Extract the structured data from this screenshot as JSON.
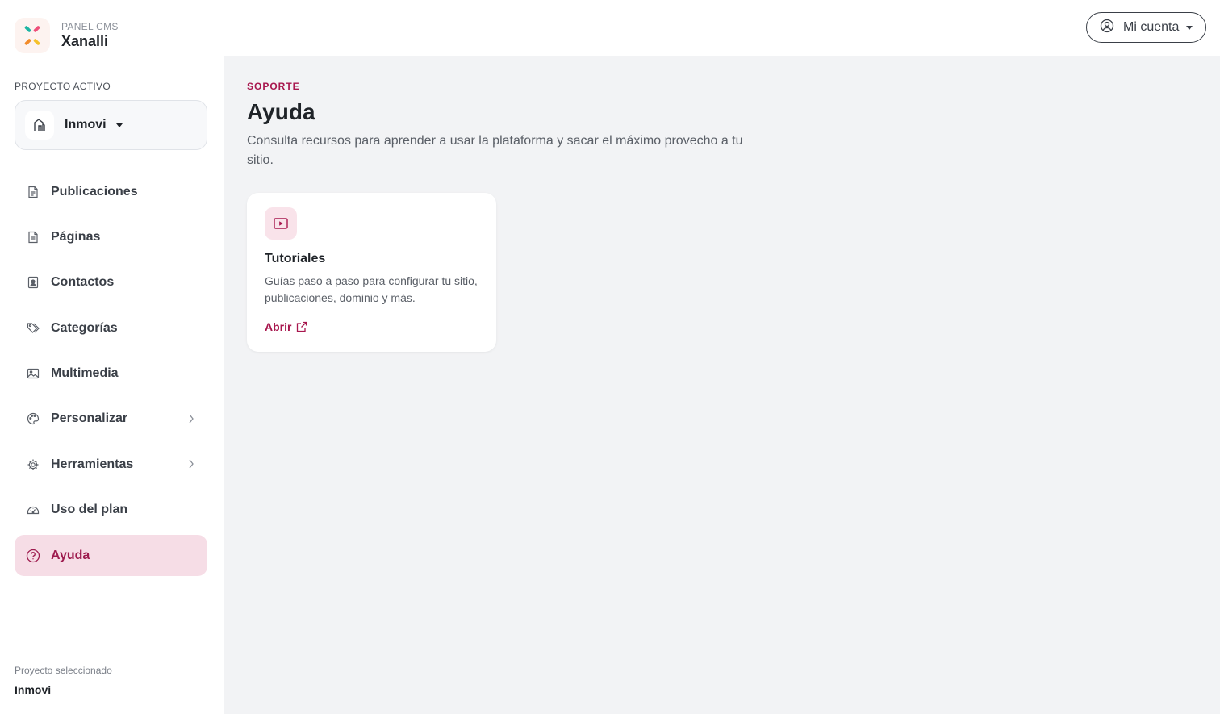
{
  "brand": {
    "small": "PANEL CMS",
    "name": "Xanalli",
    "logo_icon": "x-logo-icon"
  },
  "project": {
    "label": "PROYECTO ACTIVO",
    "name": "Inmovi",
    "avatar_icon": "house-icon"
  },
  "nav": {
    "items": [
      {
        "label": "Publicaciones",
        "icon": "document-icon"
      },
      {
        "label": "Páginas",
        "icon": "page-icon"
      },
      {
        "label": "Contactos",
        "icon": "contact-card-icon"
      },
      {
        "label": "Categorías",
        "icon": "tags-icon"
      },
      {
        "label": "Multimedia",
        "icon": "images-icon"
      },
      {
        "label": "Personalizar",
        "icon": "palette-icon",
        "has_submenu": true
      },
      {
        "label": "Herramientas",
        "icon": "gear-icon",
        "has_submenu": true
      },
      {
        "label": "Uso del plan",
        "icon": "speedometer-icon"
      },
      {
        "label": "Ayuda",
        "icon": "question-circle-icon",
        "active": true
      }
    ]
  },
  "footer": {
    "caption": "Proyecto seleccionado",
    "value": "Inmovi"
  },
  "topbar": {
    "account_label": "Mi cuenta",
    "account_icon": "user-circle-icon"
  },
  "main": {
    "eyebrow": "SOPORTE",
    "title": "Ayuda",
    "description": "Consulta recursos para aprender a usar la plataforma y sacar el máximo provecho a tu sitio."
  },
  "cards": [
    {
      "title": "Tutoriales",
      "description": "Guías paso a paso para configurar tu sitio, publicaciones, dominio y más.",
      "link_label": "Abrir",
      "icon": "play-video-icon",
      "link_icon": "external-link-icon"
    }
  ],
  "colors": {
    "accent": "#a8174e",
    "active_bg": "#f6dde6",
    "page_bg": "#f2f3f5"
  }
}
